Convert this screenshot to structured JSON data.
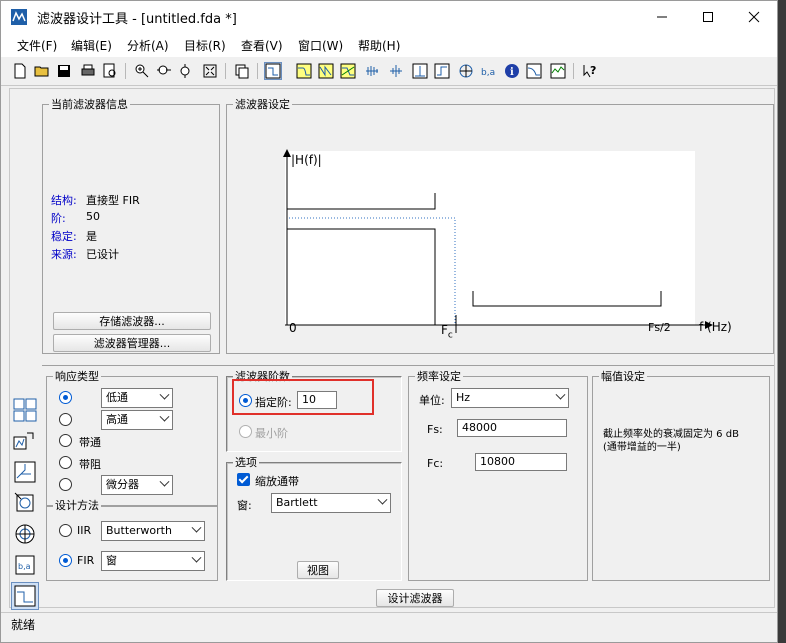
{
  "window": {
    "title": "滤波器设计工具 - [untitled.fda *]"
  },
  "menu": [
    "文件(F)",
    "编辑(E)",
    "分析(A)",
    "目标(R)",
    "查看(V)",
    "窗口(W)",
    "帮助(H)"
  ],
  "toolbar_icons": [
    "new-file-icon",
    "open-folder-icon",
    "save-icon",
    "print-icon",
    "print-preview-icon",
    "zoom-in-icon",
    "zoom-x-icon",
    "zoom-y-icon",
    "full-view-icon",
    "copy-icon",
    "filter-specs-icon",
    "magnitude-icon",
    "phase-icon",
    "magnitude-phase-icon",
    "group-delay-icon",
    "phase-delay-icon",
    "impulse-icon",
    "step-icon",
    "pole-zero-icon",
    "coefficients-icon",
    "info-icon",
    "magnitude-estimate-icon",
    "noise-power-icon",
    "help-icon"
  ],
  "info_panel": {
    "title": "当前滤波器信息",
    "structure_label": "结构:",
    "structure_value": "直接型 FIR",
    "order_label": "阶:",
    "order_value": "50",
    "stable_label": "稳定:",
    "stable_value": "是",
    "source_label": "来源:",
    "source_value": "已设计",
    "store_button": "存储滤波器...",
    "manager_button": "滤波器管理器..."
  },
  "spec_panel": {
    "title": "滤波器设定",
    "y_label": "|H(f)|",
    "x_zero": "0",
    "x_fc": "F",
    "x_fc_sub": "c",
    "x_fs2": "Fs/2",
    "x_label": "f (Hz)"
  },
  "response_type": {
    "title": "响应类型",
    "lowpass": "低通",
    "highpass": "高通",
    "bandpass": "带通",
    "bandstop": "带阻",
    "differentiator": "微分器"
  },
  "design_method": {
    "title": "设计方法",
    "iir_label": "IIR",
    "iir_value": "Butterworth",
    "fir_label": "FIR",
    "fir_value": "窗"
  },
  "filter_order": {
    "title": "滤波器阶数",
    "specify_label": "指定阶:",
    "specify_value": "10",
    "minimum_label": "最小阶"
  },
  "options": {
    "title": "选项",
    "scale_label": "缩放通带",
    "window_label": "窗:",
    "window_value": "Bartlett",
    "view_button": "视图"
  },
  "frequency": {
    "title": "频率设定",
    "unit_label": "单位:",
    "unit_value": "Hz",
    "fs_label": "Fs:",
    "fs_value": "48000",
    "fc_label": "Fc:",
    "fc_value": "10800"
  },
  "magnitude": {
    "title": "幅值设定",
    "note_line1": "截止频率处的衰减固定为 6 dB",
    "note_line2": "(通带增益的一半)"
  },
  "design_button": "设计滤波器",
  "status_text": "就绪"
}
